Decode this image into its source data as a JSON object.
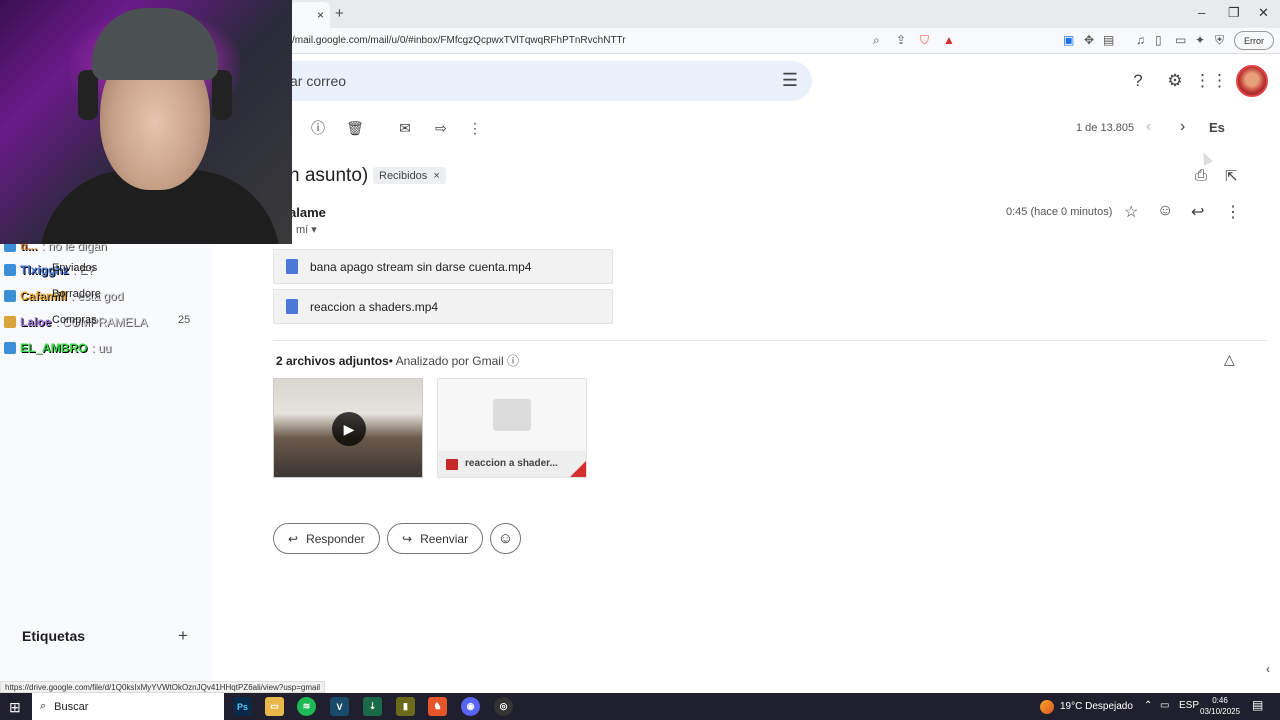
{
  "browser": {
    "tab_close": "×",
    "new_tab": "+",
    "url": "/mail.google.com/mail/u/0/#inbox/FMfcgzQcpwxTVlTqwqRFhPTnRvchNTTr",
    "error_pill": "Error",
    "window_controls": [
      "–",
      "❐",
      "✕"
    ]
  },
  "gmail": {
    "search_placeholder": "ar correo",
    "toolbar": {
      "counter": "1 de 13.805",
      "lang": "Es"
    },
    "email": {
      "subject": "n asunto)",
      "label": "Recibidos",
      "label_remove": "×",
      "sender": "alame",
      "to": "mí",
      "time": "0:45 (hace 0 minutos)"
    },
    "attachments": [
      {
        "name": "bana apago stream sin darse cuenta.mp4"
      },
      {
        "name": "reaccion a shaders.mp4"
      }
    ],
    "attachment_summary": {
      "count": "2 archivos adjuntos",
      "separator": "•",
      "scanned": "Analizado por Gmail",
      "info": "ⓘ"
    },
    "thumb2_name": "reaccion a shader...",
    "actions": {
      "reply": "Responder",
      "forward": "Reenviar"
    }
  },
  "leftpane": {
    "chat": [
      {
        "user": "ti...",
        "msg": ": no le digan"
      },
      {
        "user": "Tlxigghz",
        "msg": ": E?"
      },
      {
        "user": "Cafamill",
        "msg": ": esta god"
      },
      {
        "user": "Laloe",
        "msg": ": COMPRAMELA"
      },
      {
        "user": "EL_AMBRO",
        "msg": ": uu"
      }
    ],
    "overlay": {
      "enviados": "Enviados",
      "borradores": "Borradore",
      "compras": "Compras",
      "count": "25"
    },
    "labels_title": "Etiquetas",
    "labels_add": "+"
  },
  "status_url": "https://drive.google.com/file/d/1Q0ksIxMyYVWtOkOznJQv41HHqtPZ6ali/view?usp=gmail",
  "taskbar": {
    "search": "Buscar",
    "weather": "19°C  Despejado",
    "lang": "ESP",
    "time": "0:46",
    "date": "03/10/2025"
  },
  "colors": {
    "accent_blue": "#4a7ad8",
    "search_bg": "#eaf1fb",
    "video_red": "#c62828"
  }
}
